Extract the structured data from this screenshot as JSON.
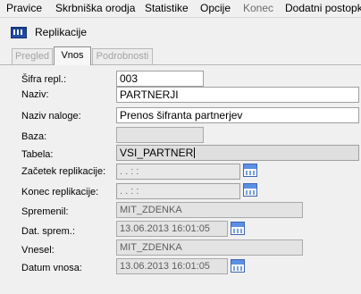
{
  "menu": {
    "items": [
      {
        "label": "Pravice"
      },
      {
        "label": "Skrbniška orodja"
      },
      {
        "label": "Statistike"
      },
      {
        "label": "Opcije"
      },
      {
        "label": "Konec"
      },
      {
        "label": "Dodatni postopk"
      }
    ]
  },
  "window": {
    "title": "Replikacije"
  },
  "tabs": [
    {
      "label": "Pregled"
    },
    {
      "label": "Vnos"
    },
    {
      "label": "Podrobnosti"
    }
  ],
  "form": {
    "sifra_label": "Šifra repl.:",
    "sifra_value": "003",
    "naziv_label": "Naziv:",
    "naziv_value": "PARTNERJI",
    "naziv_naloge_label": "Naziv naloge:",
    "naziv_naloge_value": "Prenos šifranta partnerjev",
    "baza_label": "Baza:",
    "baza_value": "",
    "tabela_label": "Tabela:",
    "tabela_value": "VSI_PARTNER",
    "zacetek_label": "Začetek replikacije:",
    "zacetek_value": ". .     : :",
    "konec_label": "Konec replikacije:",
    "konec_value": ". .     : :",
    "spremenil_label": "Spremenil:",
    "spremenil_value": "MIT_ZDENKA",
    "dat_sprem_label": "Dat. sprem.:",
    "dat_sprem_value": "13.06.2013 16:01:05",
    "vnesel_label": "Vnesel:",
    "vnesel_value": "MIT_ZDENKA",
    "datum_vnosa_label": "Datum vnosa:",
    "datum_vnosa_value": "13.06.2013 16:01:05"
  },
  "icons": {
    "window_icon": "app-logo-icon",
    "calendar": "calendar-icon"
  },
  "colors": {
    "window_bg": "#f0f0f0",
    "field_bg": "#ffffff",
    "readonly_bg": "#e3e3e3",
    "icon_blue": "#3f66b1"
  }
}
